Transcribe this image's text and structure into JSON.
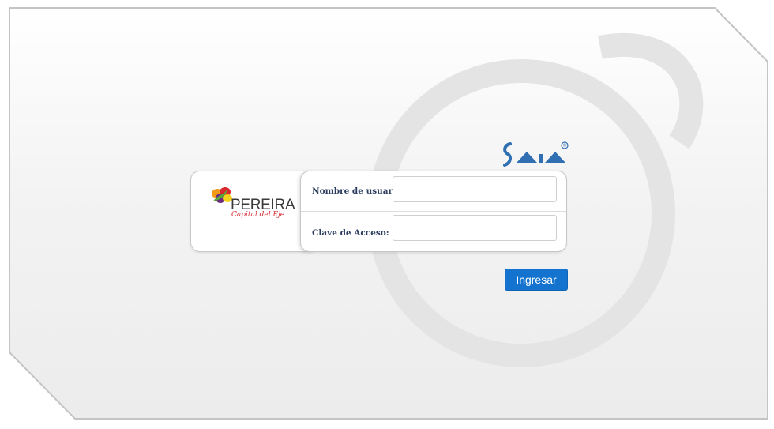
{
  "brand": {
    "name": "PEREIRA",
    "tagline": "Capital del Eje",
    "colors": {
      "red": "#d7292f",
      "orange": "#f29a1a",
      "yellow": "#f5d21b",
      "green": "#5aa63a",
      "purple": "#6b2c7b"
    }
  },
  "saia_logo": {
    "text": "SAIA",
    "mark": "®",
    "color": "#2f6fb2"
  },
  "login": {
    "username_label": "Nombre de usuario:",
    "username_value": "",
    "password_label": "Clave de Acceso:",
    "password_value": "",
    "submit_label": "Ingresar"
  },
  "colors": {
    "accent": "#1373cf",
    "label": "#2b3c5e",
    "frame_border": "#c4c4c4"
  }
}
